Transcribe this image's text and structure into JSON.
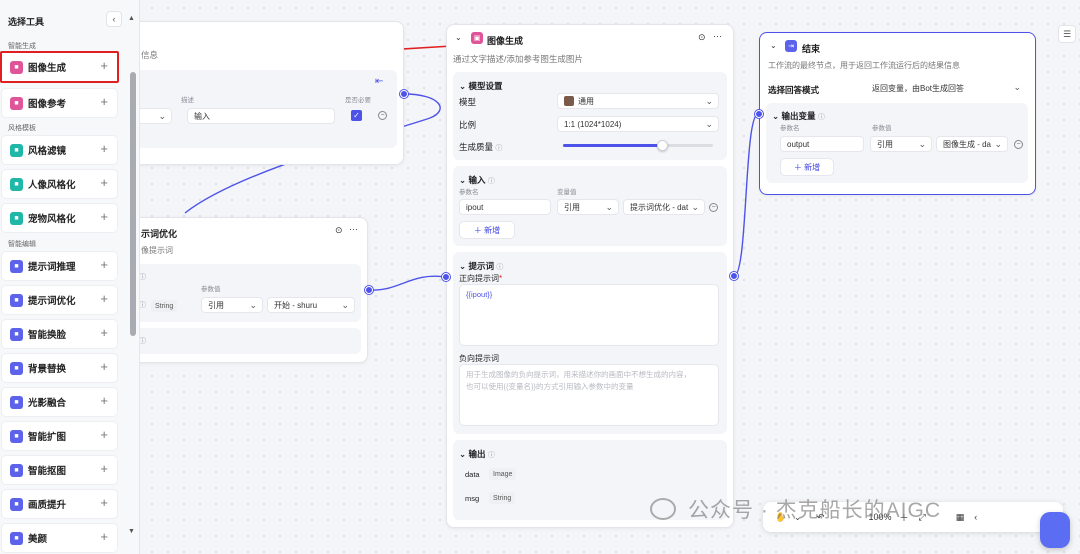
{
  "sidebar": {
    "title": "选择工具",
    "collapse_icon": "‹",
    "categories": [
      "智能生成",
      "风格模板",
      "智能编辑"
    ],
    "items": [
      {
        "label": "图像生成",
        "icon": "image-gen-icon",
        "color": "#e0559a"
      },
      {
        "label": "图像参考",
        "icon": "image-ref-icon",
        "color": "#e0559a"
      },
      {
        "label": "风格滤镜",
        "icon": "filter-icon",
        "color": "#1fb7a8"
      },
      {
        "label": "人像风格化",
        "icon": "portrait-icon",
        "color": "#1fb7a8"
      },
      {
        "label": "宠物风格化",
        "icon": "pet-icon",
        "color": "#1fb7a8"
      },
      {
        "label": "提示词推理",
        "icon": "prompt-infer-icon",
        "color": "#5c62ea"
      },
      {
        "label": "提示词优化",
        "icon": "prompt-opt-icon",
        "color": "#5c62ea"
      },
      {
        "label": "智能换脸",
        "icon": "face-swap-icon",
        "color": "#5c62ea"
      },
      {
        "label": "背景替换",
        "icon": "bg-replace-icon",
        "color": "#5c62ea"
      },
      {
        "label": "光影融合",
        "icon": "light-icon",
        "color": "#5c62ea"
      },
      {
        "label": "智能扩图",
        "icon": "expand-icon",
        "color": "#5c62ea"
      },
      {
        "label": "智能抠图",
        "icon": "cutout-icon",
        "color": "#5c62ea"
      },
      {
        "label": "画质提升",
        "icon": "quality-icon",
        "color": "#5c62ea"
      },
      {
        "label": "美颜",
        "icon": "beauty-icon",
        "color": "#5c62ea"
      }
    ],
    "plus": "+"
  },
  "start_node": {
    "subtitle_tail": "信息",
    "col2": "描述",
    "col3": "是否必要",
    "input_value": "输入"
  },
  "prompt_opt_node": {
    "title_tail": "示词优化",
    "desc_tail": "像提示词",
    "col_header": "参数值",
    "type_tag": "String",
    "select1": "引用",
    "select2": "开始 - shuru"
  },
  "image_gen_node": {
    "title": "图像生成",
    "desc": "通过文字描述/添加参考图生成图片",
    "model_section": "模型设置",
    "model_label": "模型",
    "model_value": "通用",
    "ratio_label": "比例",
    "ratio_value": "1:1 (1024*1024)",
    "quality_label": "生成质量",
    "input_section": "输入",
    "param_name_header": "参数名",
    "var_value_header": "变量值",
    "input_param": "ipout",
    "input_select": "引用",
    "input_ref": "提示词优化 - dat",
    "add_label": "新增",
    "prompt_section": "提示词",
    "positive_label": "正向提示词",
    "positive_value": "{{ipout}}",
    "negative_label": "负向提示词",
    "negative_placeholder_1": "用于生成图像的负向提示词，用来描述你的画面中不想生成的内容，",
    "negative_placeholder_2": "也可以使用{{变量名}}的方式引用输入参数中的变量",
    "output_section": "输出",
    "out1_name": "data",
    "out1_type": "Image",
    "out2_name": "msg",
    "out2_type": "String",
    "quality_fraction": 0.66
  },
  "end_node": {
    "title": "结束",
    "desc": "工作流的最终节点，用于返回工作流运行后的结果信息",
    "mode_label": "选择回答模式",
    "mode_value": "返回变量，由Bot生成回答",
    "output_section": "输出变量",
    "param_name_header": "参数名",
    "param_value_header": "参数值",
    "param": "output",
    "select": "引用",
    "ref": "图像生成 - da",
    "add_label": "新增"
  },
  "toolbar": {
    "zoom": "100%"
  },
  "watermark": "公众号 · 杰克船长的AIGC",
  "colors": {
    "accent": "#4d53e8",
    "highlight": "#e02020"
  }
}
